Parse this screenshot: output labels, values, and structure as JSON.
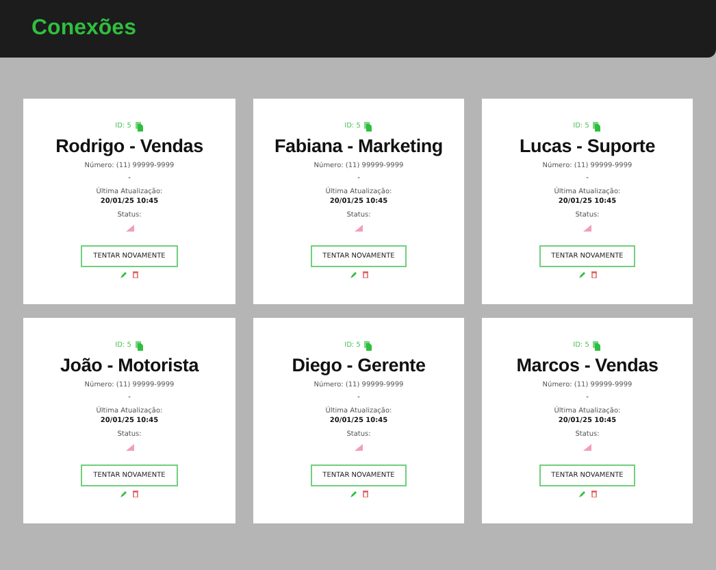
{
  "header": {
    "title": "Conexões"
  },
  "cards": [
    {
      "id": "ID: 5",
      "name": "Rodrigo - Vendas",
      "number": "Número: (11) 99999-9999",
      "dash": "-",
      "updated_label": "Última Atualização:",
      "updated": "20/01/25 10:45",
      "status_label": "Status:",
      "button": "TENTAR NOVAMENTE"
    },
    {
      "id": "ID: 5",
      "name": "Fabiana - Marketing",
      "number": "Número: (11) 99999-9999",
      "dash": "-",
      "updated_label": "Última Atualização:",
      "updated": "20/01/25 10:45",
      "status_label": "Status:",
      "button": "TENTAR NOVAMENTE"
    },
    {
      "id": "ID: 5",
      "name": "Lucas - Suporte",
      "number": "Número: (11) 99999-9999",
      "dash": "-",
      "updated_label": "Última Atualização:",
      "updated": "20/01/25 10:45",
      "status_label": "Status:",
      "button": "TENTAR NOVAMENTE"
    },
    {
      "id": "ID: 5",
      "name": "João - Motorista",
      "number": "Número: (11) 99999-9999",
      "dash": "-",
      "updated_label": "Última Atualização:",
      "updated": "20/01/25 10:45",
      "status_label": "Status:",
      "button": "TENTAR NOVAMENTE"
    },
    {
      "id": "ID: 5",
      "name": "Diego - Gerente",
      "number": "Número: (11) 99999-9999",
      "dash": "-",
      "updated_label": "Última Atualização:",
      "updated": "20/01/25 10:45",
      "status_label": "Status:",
      "button": "TENTAR NOVAMENTE"
    },
    {
      "id": "ID: 5",
      "name": "Marcos - Vendas",
      "number": "Número: (11) 99999-9999",
      "dash": "-",
      "updated_label": "Última Atualização:",
      "updated": "20/01/25 10:45",
      "status_label": "Status:",
      "button": "TENTAR NOVAMENTE"
    }
  ]
}
